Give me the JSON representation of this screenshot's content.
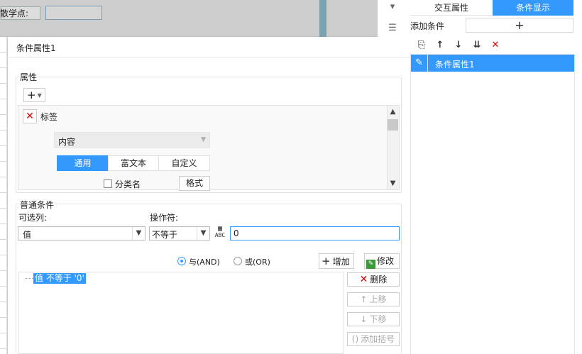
{
  "background": {
    "label": "散学点:",
    "tool_icons": [
      "collapse-icon",
      "layout-icon"
    ]
  },
  "right_panel": {
    "tabs": [
      "交互属性",
      "条件显示"
    ],
    "add_label": "添加条件",
    "add_symbol": "+",
    "toolbar_icons": [
      "copy-icon",
      "arrow-up-icon",
      "arrow-down-icon",
      "move-bottom-icon",
      "delete-icon"
    ],
    "toolbar_glyphs": [
      "⎘",
      "↑",
      "↓",
      "⇊",
      "✕"
    ],
    "items": [
      {
        "label": "条件属性1",
        "selected": true
      }
    ]
  },
  "dialog": {
    "title": "条件属性1",
    "attributes": {
      "legend": "属性",
      "add_symbol": "+",
      "tag_label": "标签",
      "content_label": "内容",
      "tabs": [
        "通用",
        "富文本",
        "自定义"
      ],
      "active_tab": "通用",
      "category_label": "分类名",
      "format_label": "格式"
    },
    "condition": {
      "legend": "普通条件",
      "column_label": "可选列:",
      "operator_label": "操作符:",
      "column_value": "值",
      "operator_value": "不等于",
      "formula_icon_text": "ABC",
      "value": "0",
      "and_label": "与(AND)",
      "or_label": "或(OR)",
      "selected_logic": "与(AND)",
      "add_label": "增加",
      "modify_label": "修改",
      "items": [
        "值 不等于 '0'"
      ],
      "delete_label": "删除",
      "up_label": "上移",
      "down_label": "下移",
      "bracket_label": "添加括号"
    }
  },
  "colors": {
    "accent": "#3399ff",
    "delete": "#dd0000",
    "modify": "#3a9a3a"
  }
}
